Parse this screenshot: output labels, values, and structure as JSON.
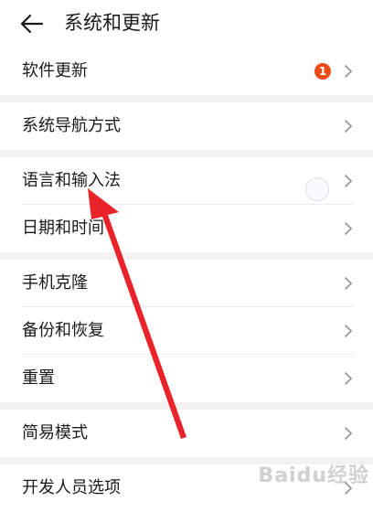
{
  "header": {
    "title": "系统和更新",
    "back_icon": "arrow-left-icon"
  },
  "sections": [
    {
      "items": [
        {
          "label": "软件更新",
          "badge": "1"
        }
      ]
    },
    {
      "items": [
        {
          "label": "系统导航方式"
        }
      ]
    },
    {
      "items": [
        {
          "label": "语言和输入法"
        },
        {
          "label": "日期和时间"
        }
      ]
    },
    {
      "items": [
        {
          "label": "手机克隆"
        },
        {
          "label": "备份和恢复"
        },
        {
          "label": "重置"
        }
      ]
    },
    {
      "items": [
        {
          "label": "简易模式"
        }
      ]
    },
    {
      "items": [
        {
          "label": "开发人员选项"
        }
      ]
    }
  ],
  "colors": {
    "badge": "#f04a19",
    "arrow": "#e8242a",
    "divider": "#f2f2f2"
  },
  "watermark": "Baidu经验"
}
